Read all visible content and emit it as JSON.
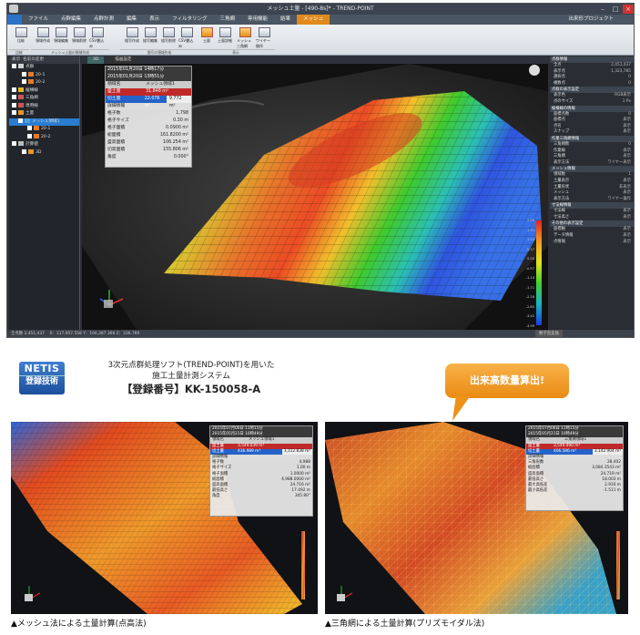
{
  "app": {
    "title": "メッシュ土量 - [490-8s]* - TREND-POINT",
    "menu": [
      "ファイル",
      "点群編集",
      "点群計測",
      "編集",
      "表示",
      "フィルタリング",
      "三角網",
      "専用機能",
      "結果",
      "メッシュ"
    ],
    "active_menu": "メッシュ",
    "right_label": "出来形プロジェクト",
    "ribbon": {
      "buttons": [
        "比較",
        "領域作成",
        "領域編集",
        "領域削除",
        "CSV書込み",
        "描写作成",
        "描写編集",
        "描写削除",
        "CSV書込み",
        "土量",
        "土量詳細",
        "メッシュ三角網",
        "ワイヤー操作"
      ],
      "groups": [
        "比較",
        "メッシュ土量の領域作成",
        "描写の領域作成",
        "表示"
      ]
    },
    "tree": {
      "tabs": [
        "表示",
        "名前の変更"
      ],
      "items": [
        "点群",
        "20-1",
        "20-2",
        "縦横線",
        "三角網",
        "専用線",
        "土量",
        "メッシュ領域1",
        "20-1",
        "20-2",
        "計算値",
        "3D"
      ]
    },
    "view_tabs": [
      "3D",
      "描画設定"
    ],
    "info": {
      "date1": "2015年01月20日 14時17分",
      "date2": "2015年01月20日 13時51分",
      "header_left": "領域名",
      "header_right": "メッシュ領域1",
      "cut_label": "盛土量",
      "cut_value": "31.848 m³",
      "fill_label": "切土量",
      "fill_value": "22.076 m³",
      "diff_value": "9.772 m³",
      "detail_header": "詳細情報",
      "details": [
        {
          "k": "格子数",
          "v": "1,798"
        },
        {
          "k": "格子サイズ",
          "v": "0.30 m"
        },
        {
          "k": "格子面積",
          "v": "0.0900 m²"
        },
        {
          "k": "総面積",
          "v": "161.8200 m²"
        },
        {
          "k": "盛高面積",
          "v": "106.254 m²"
        },
        {
          "k": "切高面積",
          "v": "155.806 m²"
        },
        {
          "k": "角度",
          "v": "0.000°"
        }
      ]
    },
    "props": {
      "sections": [
        {
          "title": "点群情報",
          "rows": [
            {
              "k": "全点",
              "v": "2,451,437"
            },
            {
              "k": "表示点",
              "v": "1,323,785"
            },
            {
              "k": "選択点",
              "v": "0"
            },
            {
              "k": "複数点",
              "v": "0"
            }
          ]
        },
        {
          "title": "点群の表示設定",
          "rows": [
            {
              "k": "表示色",
              "v": "RGB表示"
            },
            {
              "k": "点のサイズ",
              "v": "1 Px"
            }
          ]
        },
        {
          "title": "縦横線の情報",
          "rows": [
            {
              "k": "座標点数",
              "v": "0"
            },
            {
              "k": "座標点",
              "v": "表示"
            },
            {
              "k": "点名",
              "v": "表示"
            },
            {
              "k": "スナップ",
              "v": "表示"
            }
          ]
        },
        {
          "title": "作業三角網情報",
          "rows": [
            {
              "k": "三角網数",
              "v": "0"
            },
            {
              "k": "作業線",
              "v": "表示"
            },
            {
              "k": "三角網",
              "v": "表示"
            },
            {
              "k": "表示方法",
              "v": "ワイヤー表示"
            }
          ]
        },
        {
          "title": "メッシュ情報",
          "rows": [
            {
              "k": "領域数",
              "v": "1"
            },
            {
              "k": "土量表示",
              "v": "表示"
            },
            {
              "k": "土量形状",
              "v": "非表示"
            },
            {
              "k": "メッシュ",
              "v": "表示"
            },
            {
              "k": "表示方法",
              "v": "ワイヤー操作"
            }
          ]
        },
        {
          "title": "寸法線情報",
          "rows": [
            {
              "k": "寸法線",
              "v": "表示"
            },
            {
              "k": "寸法高さ",
              "v": "表示"
            }
          ]
        },
        {
          "title": "その他の表示設定",
          "rows": [
            {
              "k": "座標軸",
              "v": "表示"
            },
            {
              "k": "データ情報",
              "v": "表示"
            },
            {
              "k": "点情報",
              "v": "表示"
            }
          ]
        }
      ]
    },
    "status": "全点数 2,451,437",
    "status_coords": "X：117,957.558 Y：104,287.368 Z：336.769",
    "status_right": "数字直変換",
    "legend_ticks": [
      "2.28",
      "1.71",
      "1.14",
      "0.57",
      "0.00",
      "-0.57",
      "-1.14",
      "-1.71",
      "-2.28",
      "-2.85",
      "-3.42",
      "-3.99"
    ]
  },
  "promo": {
    "netis_line1": "NETIS",
    "netis_line2": "登録技術",
    "text_line1": "3次元点群処理ソフト(TREND-POINT)を用いた",
    "text_line2": "施工土量計測システム",
    "text_line3": "【登録番号】KK-150058-A",
    "bubble": "出来高数量算出!"
  },
  "shot_left": {
    "date1": "2015年07月06日 11時15分",
    "date2": "2015年05月21日 10時49分",
    "h_left": "領域名",
    "h_right": "メッシュ領域1",
    "cut_label": "盛土量",
    "cut_value": "3,549.039 m³",
    "fill_label": "切土量",
    "fill_value": "436.989 m³",
    "diff_value": "3,112.838 m³",
    "detail_header": "詳細情報",
    "details": [
      {
        "k": "格子数",
        "v": "4,988"
      },
      {
        "k": "格子サイズ",
        "v": "1.00 m"
      },
      {
        "k": "格子面積",
        "v": "1.0000 m²"
      },
      {
        "k": "総面積",
        "v": "4,988.0000 m²"
      },
      {
        "k": "盛高面積",
        "v": "24.716 m²"
      },
      {
        "k": "最低高さ",
        "v": "17.492 m"
      },
      {
        "k": "角度",
        "v": "345.80°"
      }
    ],
    "caption": "▲メッシュ法による土量計算(点高法)"
  },
  "shot_right": {
    "date1": "2015年07月06日 11時15分",
    "date2": "2015年05月21日 10時49分",
    "h_left": "領域名",
    "h_right": "三角網領域1",
    "cut_label": "盛土量",
    "cut_value": "3,549.490 m³",
    "fill_label": "切土量",
    "fill_value": "406.586 m³",
    "diff_value": "3,142.904 m³",
    "detail_header": "詳細情報",
    "details": [
      {
        "k": "三角形数",
        "v": "28,402"
      },
      {
        "k": "総面積",
        "v": "3,084.3543 m²"
      },
      {
        "k": "盛高面積",
        "v": "24.719 m²"
      },
      {
        "k": "最低高さ",
        "v": "18.003 m"
      },
      {
        "k": "最大高低差",
        "v": "2.916 m"
      },
      {
        "k": "最小高低差",
        "v": "-1.511 m"
      }
    ],
    "caption": "▲三角網による土量計算(プリズモイダル法)"
  }
}
